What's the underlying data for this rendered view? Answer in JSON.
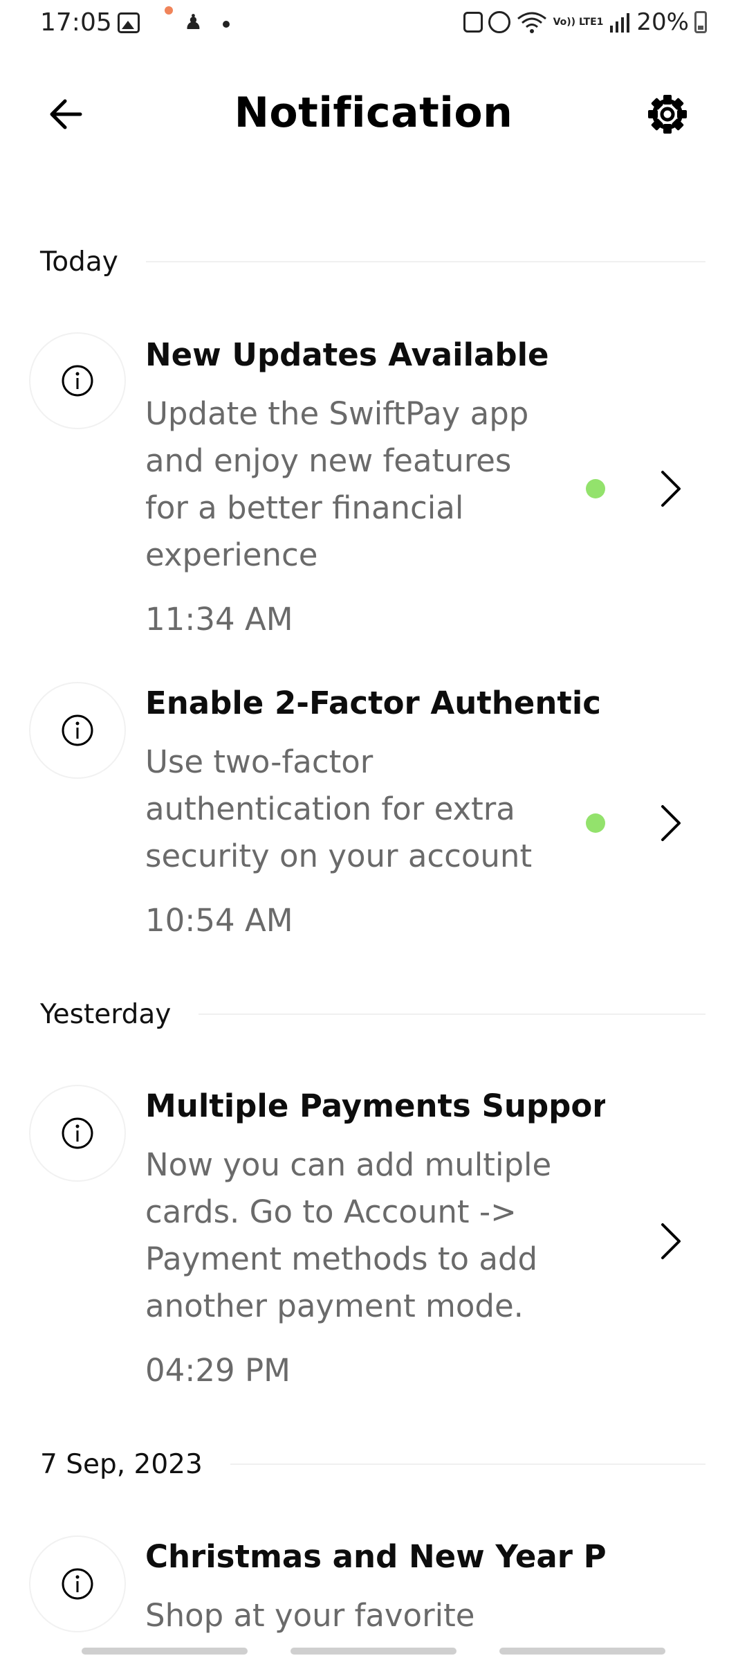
{
  "status_bar": {
    "time": "17:05",
    "lte_label": "Vo)) LTE1",
    "battery": "20%",
    "icons": [
      "gallery-icon",
      "figure-icon",
      "more-dot-icon",
      "battery-saver-icon",
      "alarm-icon",
      "wifi-icon",
      "signal-icon",
      "battery-icon"
    ]
  },
  "header": {
    "title": "Notification",
    "back_icon": "arrow-left-icon",
    "settings_icon": "gear-icon"
  },
  "colors": {
    "unread_dot": "#93e26c",
    "body_text": "#6a6a6a",
    "title_text": "#0d0d0d",
    "divider": "#f0f0f0"
  },
  "sections": [
    {
      "title": "Today",
      "items": [
        {
          "title": "New Updates Available",
          "body": "Update the SwiftPay app and enjoy new features for a better financial experience",
          "time": "11:34 AM",
          "unread": true
        },
        {
          "title": "Enable 2-Factor Authentic",
          "body": "Use two-factor authentication for extra security on your account",
          "time": "10:54 AM",
          "unread": true
        }
      ]
    },
    {
      "title": "Yesterday",
      "items": [
        {
          "title": "Multiple Payments Support U",
          "body": "Now you can add multiple cards. Go to Account -> Payment methods to add another payment mode.",
          "time": "04:29 PM",
          "unread": false
        }
      ]
    },
    {
      "title": "7 Sep, 2023",
      "items": [
        {
          "title": "Christmas and New Year Pro",
          "body": "Shop at your favorite",
          "time": "",
          "unread": false
        }
      ]
    }
  ]
}
